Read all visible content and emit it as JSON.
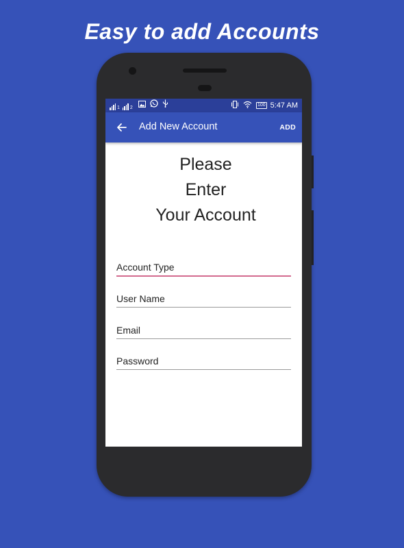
{
  "promo": {
    "headline": "Easy to add Accounts"
  },
  "status_bar": {
    "sim1": "1",
    "sim2": "2",
    "battery": "100",
    "time": "5:47 AM"
  },
  "app_bar": {
    "title": "Add New Account",
    "action_label": "ADD"
  },
  "form": {
    "prompt_lines": [
      "Please",
      "Enter",
      "Your Account"
    ],
    "fields": [
      {
        "label": "Account Type",
        "focused": true
      },
      {
        "label": "User Name",
        "focused": false
      },
      {
        "label": "Email",
        "focused": false
      },
      {
        "label": "Password",
        "focused": false
      }
    ]
  },
  "colors": {
    "background": "#3652b8",
    "status_bar": "#2b3f99",
    "app_bar": "#3652b8",
    "focus_accent": "#d36a8e"
  },
  "icons": [
    "signal-icon",
    "gallery-icon",
    "whatsapp-icon",
    "usb-icon",
    "vibrate-icon",
    "wifi-icon",
    "battery-icon",
    "back-arrow-icon"
  ]
}
